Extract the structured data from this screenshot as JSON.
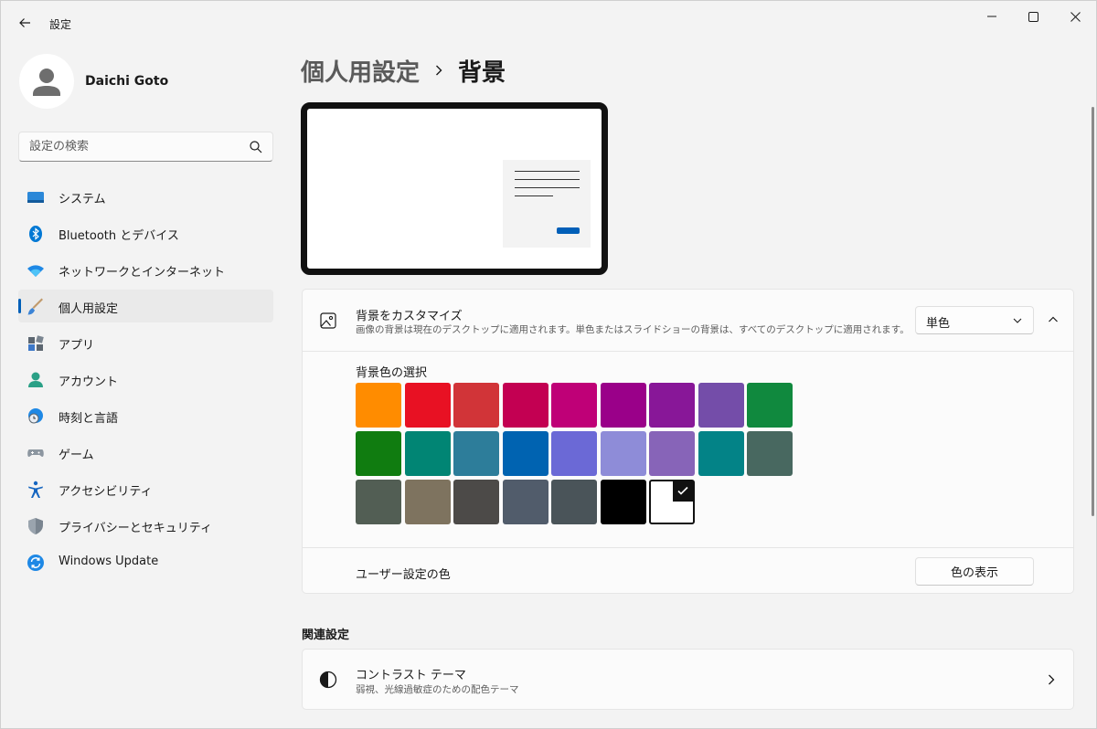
{
  "window": {
    "title": "設定",
    "controls": [
      "minimize-icon",
      "maximize-icon",
      "close-icon"
    ]
  },
  "profile": {
    "name": "Daichi Goto"
  },
  "search": {
    "placeholder": "設定の検索"
  },
  "sidebar": {
    "items": [
      {
        "label": "システム",
        "icon": "system-icon",
        "active": false
      },
      {
        "label": "Bluetooth とデバイス",
        "icon": "bluetooth-icon",
        "active": false
      },
      {
        "label": "ネットワークとインターネット",
        "icon": "wifi-icon",
        "active": false
      },
      {
        "label": "個人用設定",
        "icon": "brush-icon",
        "active": true
      },
      {
        "label": "アプリ",
        "icon": "apps-icon",
        "active": false
      },
      {
        "label": "アカウント",
        "icon": "account-icon",
        "active": false
      },
      {
        "label": "時刻と言語",
        "icon": "globe-clock-icon",
        "active": false
      },
      {
        "label": "ゲーム",
        "icon": "gamepad-icon",
        "active": false
      },
      {
        "label": "アクセシビリティ",
        "icon": "accessibility-icon",
        "active": false
      },
      {
        "label": "プライバシーとセキュリティ",
        "icon": "shield-icon",
        "active": false
      },
      {
        "label": "Windows Update",
        "icon": "update-icon",
        "active": false
      }
    ]
  },
  "breadcrumb": {
    "parent": "個人用設定",
    "current": "背景"
  },
  "background_card": {
    "title": "背景をカスタマイズ",
    "description": "画像の背景は現在のデスクトップに適用されます。単色またはスライドショーの背景は、すべてのデスクトップに適用されます。",
    "select_value": "単色",
    "color_label": "背景色の選択",
    "colors": [
      "#ff8c00",
      "#e81123",
      "#d13438",
      "#c30052",
      "#bf0077",
      "#9a0089",
      "#881798",
      "#744da9",
      "#10893e",
      "#107c10",
      "#018574",
      "#2d7d9a",
      "#0063b1",
      "#6b69d6",
      "#8e8cd8",
      "#8764b8",
      "#038387",
      "#486860",
      "#525e54",
      "#7e735f",
      "#4c4a48",
      "#515c6b",
      "#4a5459",
      "#000000",
      "#ffffff"
    ],
    "selected_index": 24,
    "custom_label": "ユーザー設定の色",
    "custom_button": "色の表示"
  },
  "related": {
    "heading": "関連設定",
    "items": [
      {
        "title": "コントラスト テーマ",
        "description": "弱視、光線過敏症のための配色テーマ",
        "icon": "contrast-icon"
      }
    ]
  },
  "accent": "#005fb8"
}
